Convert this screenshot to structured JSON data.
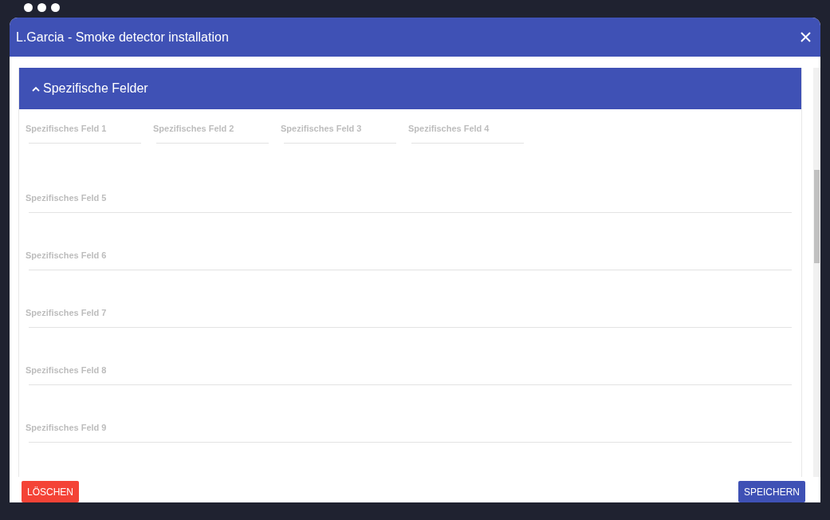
{
  "window": {
    "title": "L.Garcia - Smoke detector installation"
  },
  "panel": {
    "title": "Spezifische Felder",
    "expanded": true,
    "fields": [
      {
        "kind": "short",
        "label": "Spezifisches Feld 1"
      },
      {
        "kind": "short",
        "label": "Spezifisches Feld 2"
      },
      {
        "kind": "short",
        "label": "Spezifisches Feld 3"
      },
      {
        "kind": "short",
        "label": "Spezifisches Feld 4"
      },
      {
        "kind": "wide",
        "label": "Spezifisches Feld 5"
      },
      {
        "kind": "wide",
        "label": "Spezifisches Feld 6"
      },
      {
        "kind": "wide",
        "label": "Spezifisches Feld 7"
      },
      {
        "kind": "wide",
        "label": "Spezifisches Feld 8"
      },
      {
        "kind": "wide",
        "label": "Spezifisches Feld 9"
      }
    ]
  },
  "buttons": [
    {
      "kind": "delete",
      "label": "LÖSCHEN"
    },
    {
      "kind": "save",
      "label": "SPEICHERN"
    }
  ]
}
